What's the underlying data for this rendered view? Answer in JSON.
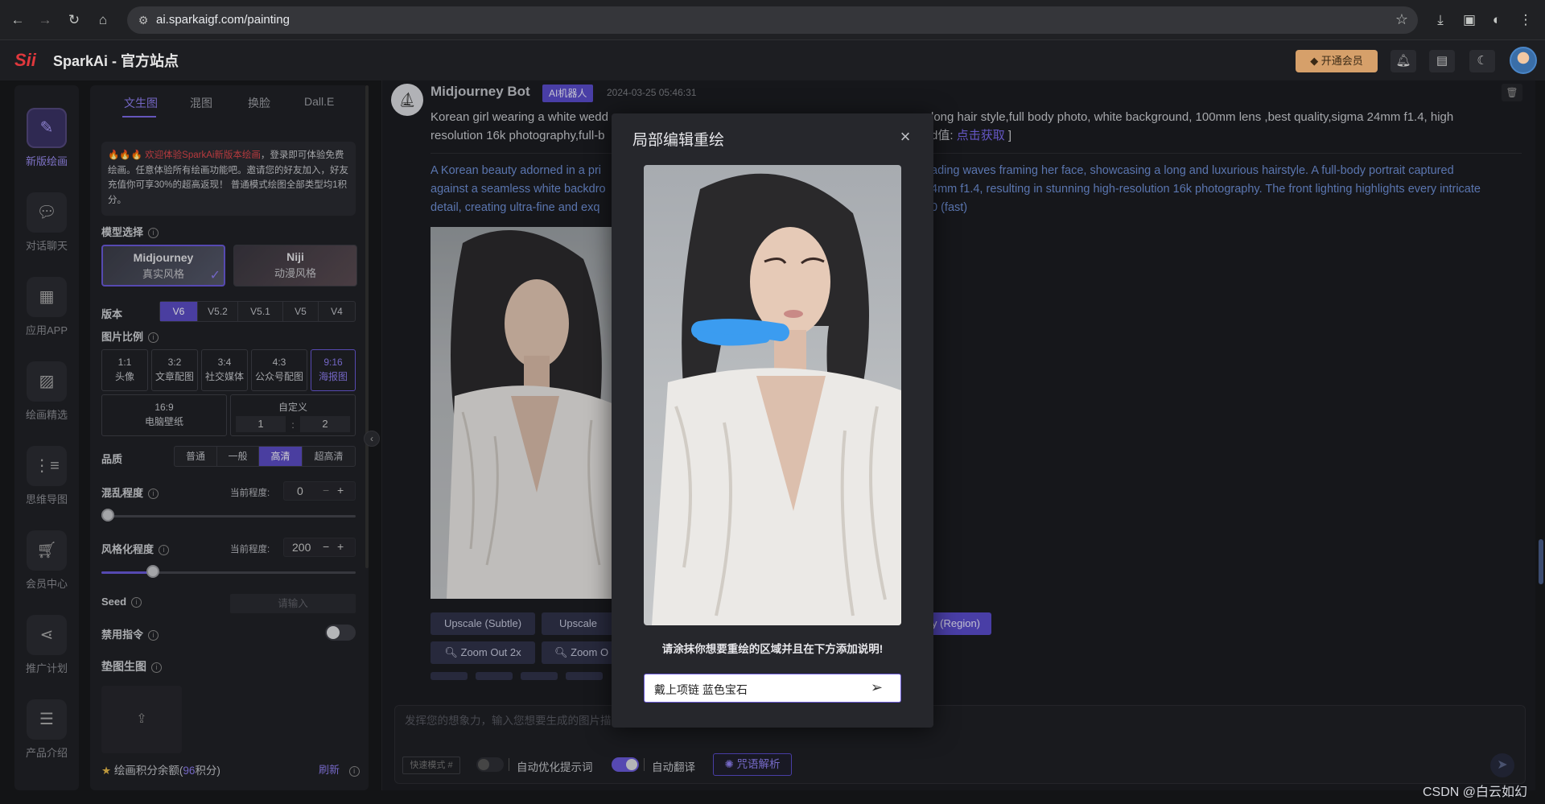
{
  "browser": {
    "url": "ai.sparkaigf.com/painting"
  },
  "app": {
    "title": "SparkAi - 官方站点",
    "logo_text": "Sii",
    "vip_label": "开通会员"
  },
  "nav": [
    {
      "label": "新版绘画",
      "icon": "brush-icon"
    },
    {
      "label": "对话聊天",
      "icon": "chat-icon"
    },
    {
      "label": "应用APP",
      "icon": "apps-icon"
    },
    {
      "label": "绘画精选",
      "icon": "gallery-icon"
    },
    {
      "label": "思维导图",
      "icon": "mindmap-icon"
    },
    {
      "label": "会员中心",
      "icon": "cart-icon"
    },
    {
      "label": "推广计划",
      "icon": "share-icon"
    },
    {
      "label": "产品介绍",
      "icon": "product-icon"
    }
  ],
  "settings": {
    "tabs": [
      "文生图",
      "混图",
      "换脸",
      "Dall.E"
    ],
    "notice_red": "🔥🔥🔥 欢迎体验SparkAi新版本绘画",
    "notice_rest": "，登录即可体验免费绘画。任意体验所有绘画功能吧。邀请您的好友加入，好友充值你可享30%的超高返现！ 普通模式绘图全部类型均1积分。",
    "model_label": "模型选择",
    "models": [
      {
        "name": "Midjourney",
        "desc": "真实风格"
      },
      {
        "name": "Niji",
        "desc": "动漫风格"
      }
    ],
    "version_label": "版本",
    "versions": [
      "V6",
      "V5.2",
      "V5.1",
      "V5",
      "V4"
    ],
    "ratio_label": "图片比例",
    "ratios": [
      {
        "r": "1:1",
        "d": "头像"
      },
      {
        "r": "3:2",
        "d": "文章配图"
      },
      {
        "r": "3:4",
        "d": "社交媒体"
      },
      {
        "r": "4:3",
        "d": "公众号配图"
      },
      {
        "r": "9:16",
        "d": "海报图"
      },
      {
        "r": "16:9",
        "d": "电脑壁纸"
      }
    ],
    "custom_label": "自定义",
    "custom_w": "1",
    "custom_sep": ":",
    "custom_h": "2",
    "quality_label": "品质",
    "qualities": [
      "普通",
      "一般",
      "高清",
      "超高清"
    ],
    "chaos_label": "混乱程度",
    "chaos_current": "当前程度:",
    "chaos_value": "0",
    "stylize_label": "风格化程度",
    "stylize_current": "当前程度:",
    "stylize_value": "200",
    "seed_label": "Seed",
    "seed_placeholder": "请输入",
    "noprompt_label": "禁用指令",
    "refimg_label": "垫图生图",
    "credits_prefix": "绘画积分余额(",
    "credits_value": "96",
    "credits_suffix": "积分)",
    "refresh": "刷新"
  },
  "message": {
    "bot_name": "Midjourney Bot",
    "badge": "AI机器人",
    "time": "2024-03-25 05:46:31",
    "prompt_left_1": "Korean girl wearing a white wedd",
    "prompt_left_2": "resolution 16k photography,full-b",
    "prompt_right_1": "long hair style,full body photo, white background, 100mm lens ,best quality,sigma 24mm f1.4, high",
    "prompt_right_2_pre": "d值: ",
    "prompt_right_2_link": "点击获取",
    "prompt_right_2_post": " ]",
    "en_left_1": "A Korean beauty adorned in a pri",
    "en_left_2": "against a seamless white backdro",
    "en_left_3": "detail, creating ultra-fine and exq",
    "en_right_1": "ading waves framing her face, showcasing a long and luxurious hairstyle. A full-body portrait captured",
    "en_right_2": "4mm f1.4, resulting in stunning high-resolution 16k photography. The front lighting highlights every intricate",
    "en_right_3": "0  (fast)",
    "actions": {
      "upscale_subtle": "Upscale (Subtle)",
      "upscale_cr": "Upscale (Cr",
      "region": "y (Region)",
      "zoom2x": "Zoom Out 2x",
      "zoom_o": "Zoom O"
    }
  },
  "input": {
    "placeholder": "发挥您的想象力，输入您想要生成的图片描",
    "quick_mode": "快速模式 #",
    "auto_optimize": "自动优化提示词",
    "auto_translate": "自动翻译",
    "parse": "咒语解析"
  },
  "modal": {
    "title": "局部编辑重绘",
    "hint": "请涂抹你想要重绘的区域并且在下方添加说明!",
    "input_value": "戴上项链 蓝色宝石"
  },
  "watermark": "CSDN @白云如幻",
  "colors": {
    "accent": "#5b4cc4",
    "mask": "#3b9cf0",
    "vip": "#d6a06a"
  }
}
